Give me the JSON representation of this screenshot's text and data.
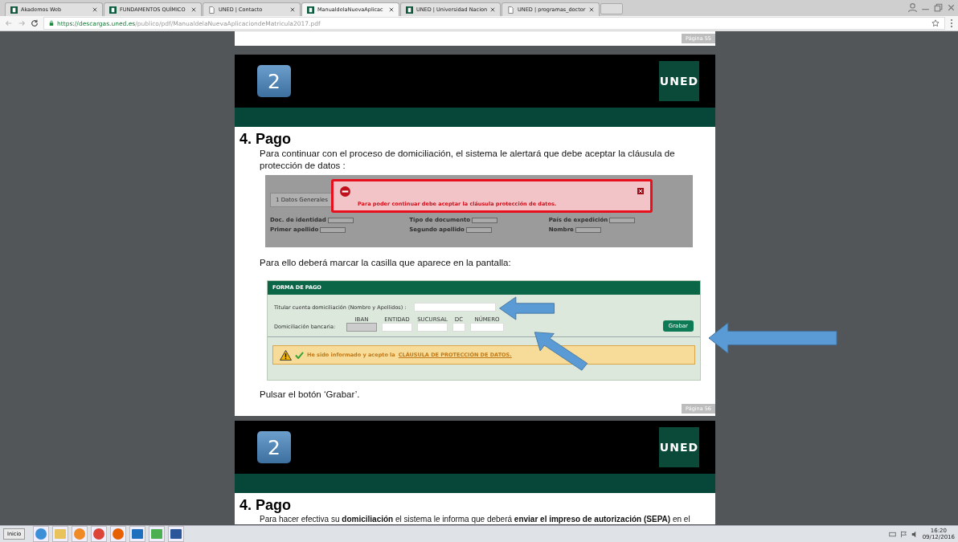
{
  "browser": {
    "tabs": [
      {
        "title": "Akademos Web",
        "kind": "app",
        "selected": false
      },
      {
        "title": "FUNDAMENTOS QUÍMICO",
        "kind": "app",
        "selected": false
      },
      {
        "title": "UNED | Contacto",
        "kind": "page",
        "selected": false
      },
      {
        "title": "ManualdelaNuevaAplicac",
        "kind": "app",
        "selected": true
      },
      {
        "title": "UNED | Universidad Nacion",
        "kind": "app",
        "selected": false
      },
      {
        "title": "UNED | programas_doctor",
        "kind": "page",
        "selected": false
      }
    ],
    "address": {
      "host": "https://descargas.uned.es",
      "path": "/publico/pdf/ManualdelaNuevaAplicaciondeMatricula2017.pdf"
    }
  },
  "prev_page_footer": "Página 55",
  "page": {
    "badge": "2",
    "logo": "UNED",
    "heading": "4. Pago",
    "intro": "Para continuar con el proceso de domiciliación, el sistema le alertará que debe aceptar la cláusula de protección de datos :",
    "alert_shot": {
      "tab": "1 Datos Generales",
      "fields": [
        "Doc. de identidad",
        "Tipo de documento",
        "País de expedición",
        "Primer apellido",
        "Segundo apellido",
        "Nombre"
      ],
      "message": "Para poder continuar debe aceptar la cláusula protección de datos."
    },
    "instruction": "Para ello deberá marcar la casilla que aparece en la pantalla:",
    "form": {
      "title": "FORMA DE PAGO",
      "holder_label": "Titular cuenta domiciliación (Nombre y Apellidos) :",
      "bank_label": "Domiciliación bancaria:",
      "bank_fields": [
        "IBAN",
        "ENTIDAD",
        "SUCURSAL",
        "DC",
        "NÚMERO"
      ],
      "button": "Grabar",
      "consent_text": "He sido informado y acepto la",
      "consent_link": "CLÁUSULA DE PROTECCIÓN DE DATOS.",
      "consent_checked": true
    },
    "closing": "Pulsar el botón ‘Grabar’.",
    "footer": "Página 56"
  },
  "next_page": {
    "badge": "2",
    "logo": "UNED",
    "heading": "4. Pago",
    "text": "Para hacer efectiva su **domiciliación** el sistema le informa que deberá **enviar el impreso de autorización (SEPA)** en el"
  },
  "taskbar": {
    "start": "Inicio",
    "time": "16:20",
    "date": "09/12/2016"
  }
}
